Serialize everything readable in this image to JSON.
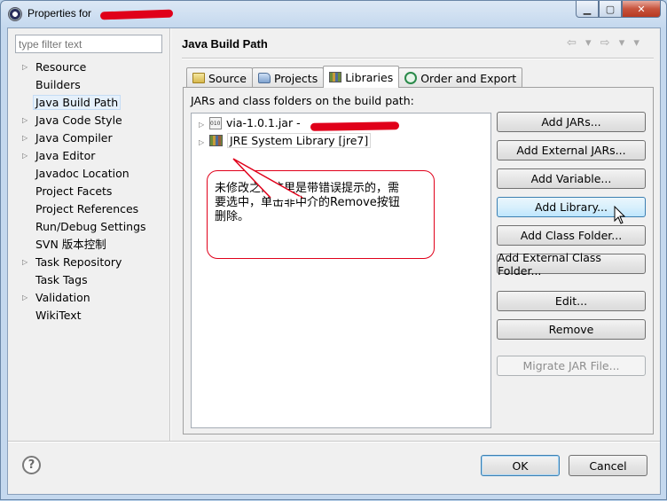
{
  "window": {
    "title": "Properties for",
    "minimize_glyph": "▁",
    "maximize_glyph": "▢",
    "close_glyph": "✕"
  },
  "sidebar": {
    "filter_placeholder": "type filter text",
    "items": [
      {
        "label": "Resource",
        "expandable": true
      },
      {
        "label": "Builders",
        "expandable": false
      },
      {
        "label": "Java Build Path",
        "expandable": false,
        "selected": true
      },
      {
        "label": "Java Code Style",
        "expandable": true
      },
      {
        "label": "Java Compiler",
        "expandable": true
      },
      {
        "label": "Java Editor",
        "expandable": true
      },
      {
        "label": "Javadoc Location",
        "expandable": false
      },
      {
        "label": "Project Facets",
        "expandable": false
      },
      {
        "label": "Project References",
        "expandable": false
      },
      {
        "label": "Run/Debug Settings",
        "expandable": false
      },
      {
        "label": "SVN 版本控制",
        "expandable": false
      },
      {
        "label": "Task Repository",
        "expandable": true
      },
      {
        "label": "Task Tags",
        "expandable": false
      },
      {
        "label": "Validation",
        "expandable": true
      },
      {
        "label": "WikiText",
        "expandable": false
      }
    ],
    "arrow_glyph": "▷"
  },
  "page": {
    "title": "Java Build Path",
    "nav_glyphs": "⇦ ▾ ⇨ ▾ ▾"
  },
  "tabs": [
    {
      "label": "Source",
      "icon": "source-folder-icon"
    },
    {
      "label": "Projects",
      "icon": "project-icon"
    },
    {
      "label": "Libraries",
      "icon": "library-icon",
      "active": true
    },
    {
      "label": "Order and Export",
      "icon": "order-export-icon"
    }
  ],
  "libraries": {
    "list_label": "JARs and class folders on the build path:",
    "entries": [
      {
        "label": "via-1.0.1.jar - ",
        "icon": "jar-icon"
      },
      {
        "label": "JRE System Library [jre7]",
        "icon": "library-icon"
      }
    ],
    "buttons": [
      {
        "label": "Add JARs...",
        "state": "normal"
      },
      {
        "label": "Add External JARs...",
        "state": "normal"
      },
      {
        "label": "Add Variable...",
        "state": "normal"
      },
      {
        "label": "Add Library...",
        "state": "hover"
      },
      {
        "label": "Add Class Folder...",
        "state": "normal"
      },
      {
        "label": "Add External Class Folder...",
        "state": "normal"
      },
      {
        "label": "Edit...",
        "state": "normal"
      },
      {
        "label": "Remove",
        "state": "normal"
      },
      {
        "label": "Migrate JAR File...",
        "state": "disabled"
      }
    ]
  },
  "annotation": {
    "callout_text": "未修改之前这里是带错误提示的，需要选中，单击非中介的Remove按钮删除。",
    "color": "#e0001a"
  },
  "footer": {
    "help_glyph": "?",
    "ok_label": "OK",
    "cancel_label": "Cancel"
  }
}
